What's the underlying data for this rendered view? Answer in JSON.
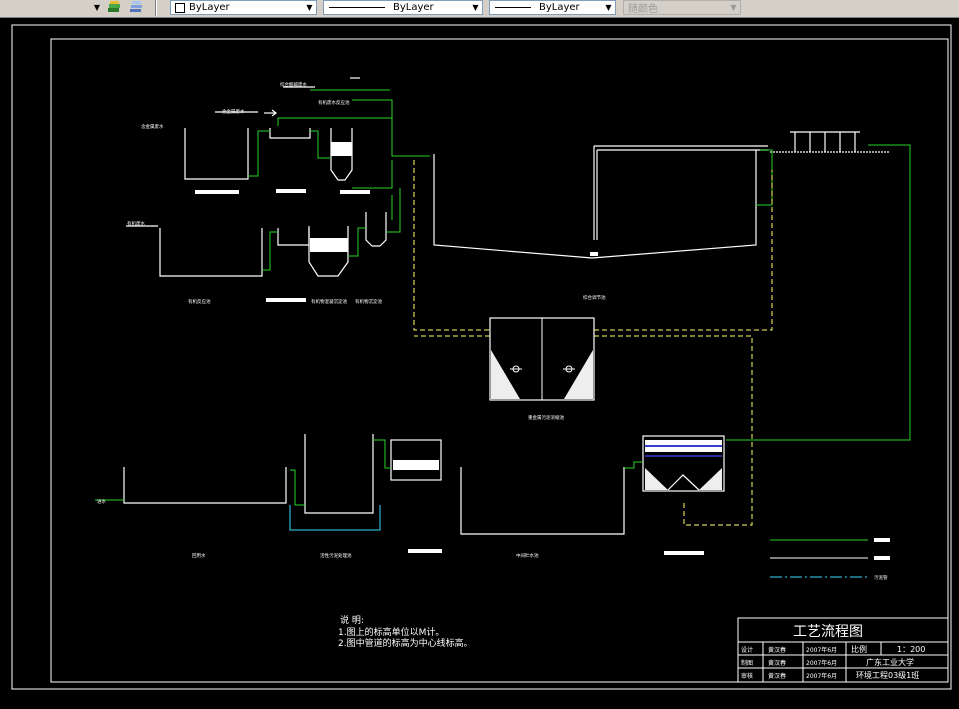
{
  "toolbar": {
    "color_combo": "ByLayer",
    "linetype_combo": "ByLayer",
    "lineweight_combo": "ByLayer",
    "plotstyle_combo": "随颜色"
  },
  "drawing": {
    "tank_labels": {
      "t1": "有机废水",
      "t2": "有机反应池",
      "t3": "有机物混凝沉淀池",
      "t4": "有机物沉淀池",
      "equalization": "综合调节池",
      "sludge": "重金属污泥浓缩池",
      "reuse": "回用水",
      "aeration": "活性污泥处理池",
      "clear": "中间贮水池",
      "inflow": "进水",
      "heavy_metal": "含金属废水",
      "metal_reaction": "有机废水反应池",
      "acid_ww": "综合酸碱废水"
    },
    "legend": {
      "sludge_pipe": "污泥管"
    }
  },
  "notes": {
    "title": "说 明:",
    "line1": "1.图上的标高单位以M计。",
    "line2": "2.图中管道的标高为中心线标高。"
  },
  "title_block": {
    "title": "工艺流程图",
    "scale_label": "比例",
    "scale_value": "1：200",
    "rows": [
      {
        "role": "设计",
        "name": "黄汉春",
        "date": "2007年6月"
      },
      {
        "role": "制图",
        "name": "黄汉春",
        "date": "2007年6月"
      },
      {
        "role": "审核",
        "name": "黄汉春",
        "date": "2007年6月"
      }
    ],
    "school": "广东工业大学",
    "class": "环境工程03级1班"
  },
  "colors": {
    "background": "#000000",
    "lines": "#ffffff",
    "pipe_green": "#27d22c",
    "pipe_yellow": "#ffff66",
    "pipe_cyan": "#3cd7ff",
    "toolbar": "#d4d0c8"
  }
}
